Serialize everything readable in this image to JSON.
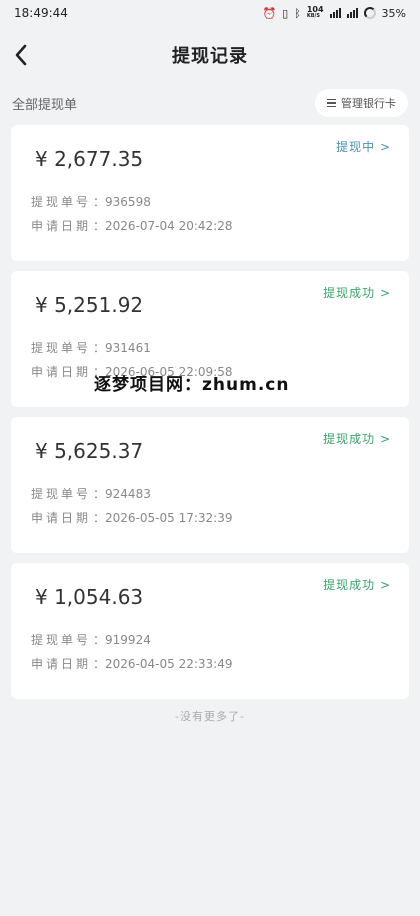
{
  "status_bar": {
    "time": "18:49:44",
    "network_speed": "104",
    "network_unit": "KB/S",
    "battery": "35%"
  },
  "header": {
    "title": "提现记录"
  },
  "subheader": {
    "section_label": "全部提现单",
    "manage_label": "管理银行卡"
  },
  "labels": {
    "order_no": "提现单号",
    "apply_date": "申请日期"
  },
  "colors": {
    "status_processing": "#4a90b8",
    "status_success": "#3aa56a"
  },
  "records": [
    {
      "amount": "¥ 2,677.35",
      "status": "提现中 >",
      "order_no": "936598",
      "date": "2026-07-04 20:42:28"
    },
    {
      "amount": "¥ 5,251.92",
      "status": "提现成功 >",
      "order_no": "931461",
      "date": "2026-06-05 22:09:58"
    },
    {
      "amount": "¥ 5,625.37",
      "status": "提现成功 >",
      "order_no": "924483",
      "date": "2026-05-05 17:32:39"
    },
    {
      "amount": "¥ 1,054.63",
      "status": "提现成功 >",
      "order_no": "919924",
      "date": "2026-04-05 22:33:49"
    }
  ],
  "footer_text": "-没有更多了-",
  "watermark": "逐梦项目网：zhum.cn"
}
